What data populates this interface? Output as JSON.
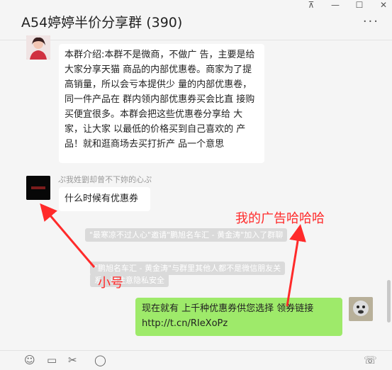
{
  "window": {
    "title": "A54婷婷半价分享群 (390)",
    "pin_label": "⊼",
    "minimize_label": "—",
    "maximize_label": "☐",
    "close_label": "✕",
    "more_label": "···"
  },
  "messages": {
    "intro": {
      "text": "本群介绍:本群不是微商，不做广 告，主要是给大家分享天猫 商品的内部优惠卷。商家为了提高销量，所以会亏本提供少 量的内部优惠卷，同一件产品在 群内领内部优惠券买会比直 接购买便宜很多。本群会把这些优惠卷分享给 大家，让大家 以最低的价格买到自己喜欢的 产品！就和逛商场去买打折产 品一个意思"
    },
    "question": {
      "sender": "ぷ我姓劉却曾不下妳的心ぷ",
      "text": "什么时候有优惠券"
    },
    "system1": "\"最寒凉不过人心\"邀请\"鹏旭名车汇 - 黄金涛\"加入了群聊",
    "system2_line1": "\"鹏旭名车汇 - 黄金涛\"与群里其他人都不是微信朋友关",
    "system2_line2": "系，请注意隐私安全",
    "ad": {
      "text": "现在就有 上千种优惠券供您选择 领券链接 http://t.cn/RIeXoPz"
    }
  },
  "annotations": {
    "ad_label": "我的广告哈哈哈",
    "alt_label": "小号",
    "color": "#ff2a2a"
  },
  "toolbar": {
    "emoji": "☺",
    "folder": "▭",
    "scissors": "✂",
    "chat": "◯",
    "phone": "☏"
  }
}
